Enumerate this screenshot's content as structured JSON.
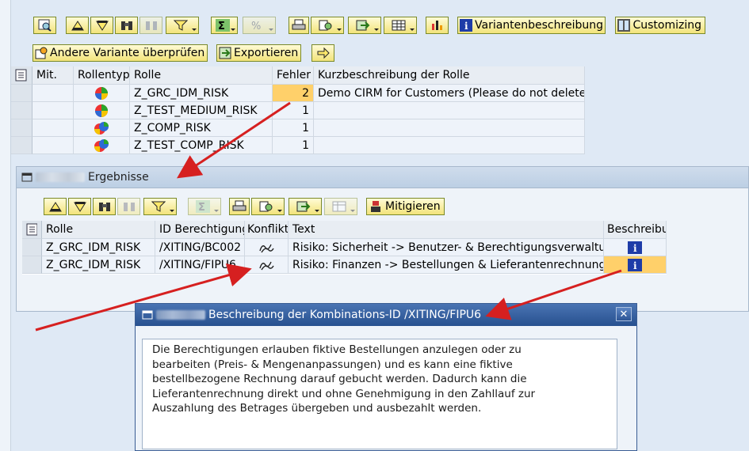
{
  "toolbar1": {
    "buttons": [
      {
        "name": "find-icon"
      },
      {
        "name": "sort-ascending-icon"
      },
      {
        "name": "sort-descending-icon"
      },
      {
        "name": "find-next-icon"
      },
      {
        "name": "print-preview-icon"
      },
      {
        "name": "filter-icon"
      },
      {
        "name": "sum-icon"
      },
      {
        "name": "subtotal-icon"
      },
      {
        "name": "print-icon"
      },
      {
        "name": "layout-icon"
      },
      {
        "name": "export-icon"
      },
      {
        "name": "spreadsheet-icon"
      },
      {
        "name": "graphic-icon"
      }
    ],
    "variant_description_label": "Variantenbeschreibung",
    "customizing_label": "Customizing",
    "check_other_variant_label": "Andere Variante überprüfen",
    "export_label": "Exportieren"
  },
  "roles_table": {
    "headers": [
      "Mit.",
      "Rollentyp",
      "Rolle",
      "Fehler",
      "Kurzbeschreibung der Rolle"
    ],
    "rows": [
      {
        "rolle": "Z_GRC_IDM_RISK",
        "fehler": "2",
        "beschreibung": "Demo CIRM for Customers (Please do not delete!)",
        "type_icon": "single-role-icon"
      },
      {
        "rolle": "Z_TEST_MEDIUM_RISK",
        "fehler": "1",
        "beschreibung": "",
        "type_icon": "single-role-icon"
      },
      {
        "rolle": "Z_COMP_RISK",
        "fehler": "1",
        "beschreibung": "",
        "type_icon": "composite-role-icon"
      },
      {
        "rolle": "Z_TEST_COMP_RISK",
        "fehler": "1",
        "beschreibung": "",
        "type_icon": "composite-role-icon"
      }
    ]
  },
  "results_panel": {
    "title": "Ergebnisse",
    "mitigate_label": "Mitigieren",
    "headers": [
      "Rolle",
      "ID Berechtigung",
      "Konflikt",
      "Text",
      "Beschreibu"
    ],
    "rows": [
      {
        "rolle": "Z_GRC_IDM_RISK",
        "id": "/XITING/BC002",
        "text": "Risiko: Sicherheit -> Benutzer- & Berechtigungsverwaltung"
      },
      {
        "rolle": "Z_GRC_IDM_RISK",
        "id": "/XITING/FIPU6",
        "text": "Risiko: Finanzen -> Bestellungen & Lieferantenrechnungen"
      }
    ]
  },
  "dialog": {
    "title": "Beschreibung der Kombinations-ID /XITING/FIPU6",
    "lines": [
      "Die Berechtigungen erlauben fiktive Bestellungen anzulegen oder zu",
      "bearbeiten (Preis- & Mengenanpassungen) und es kann eine fiktive",
      "bestellbezogene Rechnung darauf gebucht werden. Dadurch kann die",
      "Lieferantenrechnung direkt und ohne Genehmigung in den Zahllauf zur",
      "Auszahlung des Betrages übergeben und ausbezahlt werden."
    ]
  },
  "colors": {
    "accent_yellow": "#f2e37a",
    "highlight": "#ffd06a",
    "title_blue": "#27508f",
    "arrow_red": "#d62020"
  }
}
